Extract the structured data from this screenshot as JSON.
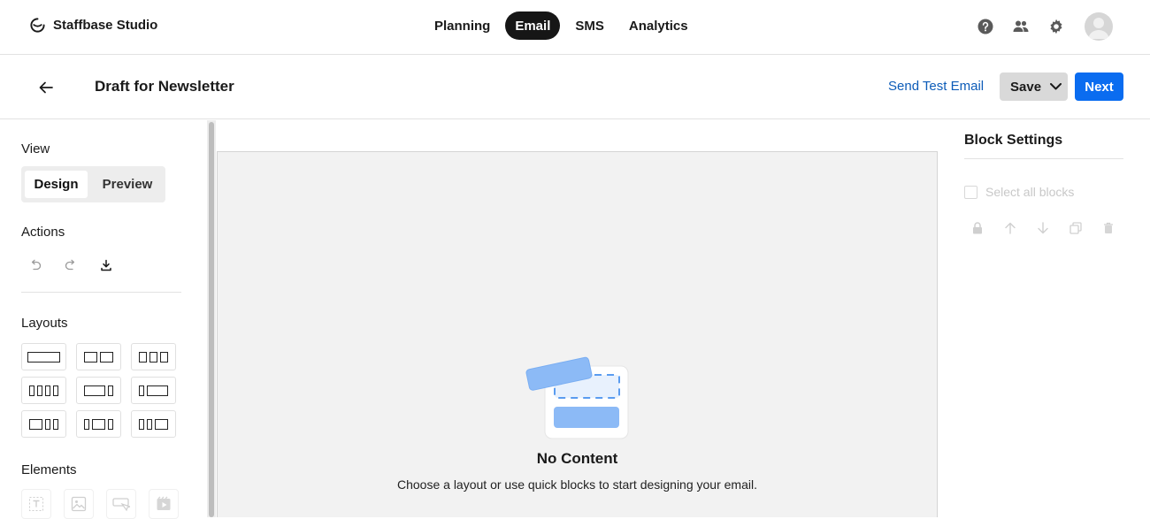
{
  "brand": {
    "name": "Staffbase Studio",
    "icon": "staffbase-logo-icon"
  },
  "nav": {
    "tabs": [
      {
        "label": "Planning",
        "active": false
      },
      {
        "label": "Email",
        "active": true
      },
      {
        "label": "SMS",
        "active": false
      },
      {
        "label": "Analytics",
        "active": false
      }
    ],
    "icons": [
      "help-icon",
      "users-icon",
      "gear-icon"
    ]
  },
  "header": {
    "title": "Draft for Newsletter",
    "send_test_label": "Send Test Email",
    "save_label": "Save",
    "next_label": "Next"
  },
  "sidebar": {
    "view_title": "View",
    "view_options": [
      "Design",
      "Preview"
    ],
    "view_selected": "Design",
    "actions_title": "Actions",
    "actions": [
      "undo-icon",
      "redo-icon",
      "download-icon"
    ],
    "layouts_title": "Layouts",
    "layouts": [
      "one-column",
      "two-columns",
      "three-columns",
      "four-columns",
      "wide-narrow",
      "narrow-wide",
      "wide-narrow-narrow",
      "narrow-wide-narrow",
      "narrow-narrow-wide"
    ],
    "elements_title": "Elements",
    "elements": [
      "text-icon",
      "image-icon",
      "button-icon",
      "video-icon"
    ]
  },
  "canvas": {
    "empty_title": "No Content",
    "empty_subtitle": "Choose a layout or use quick blocks to start designing your email."
  },
  "block_settings": {
    "title": "Block Settings",
    "select_all_label": "Select all blocks",
    "tools": [
      "lock-icon",
      "arrow-up-icon",
      "arrow-down-icon",
      "duplicate-icon",
      "trash-icon"
    ]
  },
  "colors": {
    "accent": "#0a6cf0",
    "link": "#0d5cb8",
    "active_tab": "#161616",
    "canvas_bg": "#f2f2f2"
  }
}
